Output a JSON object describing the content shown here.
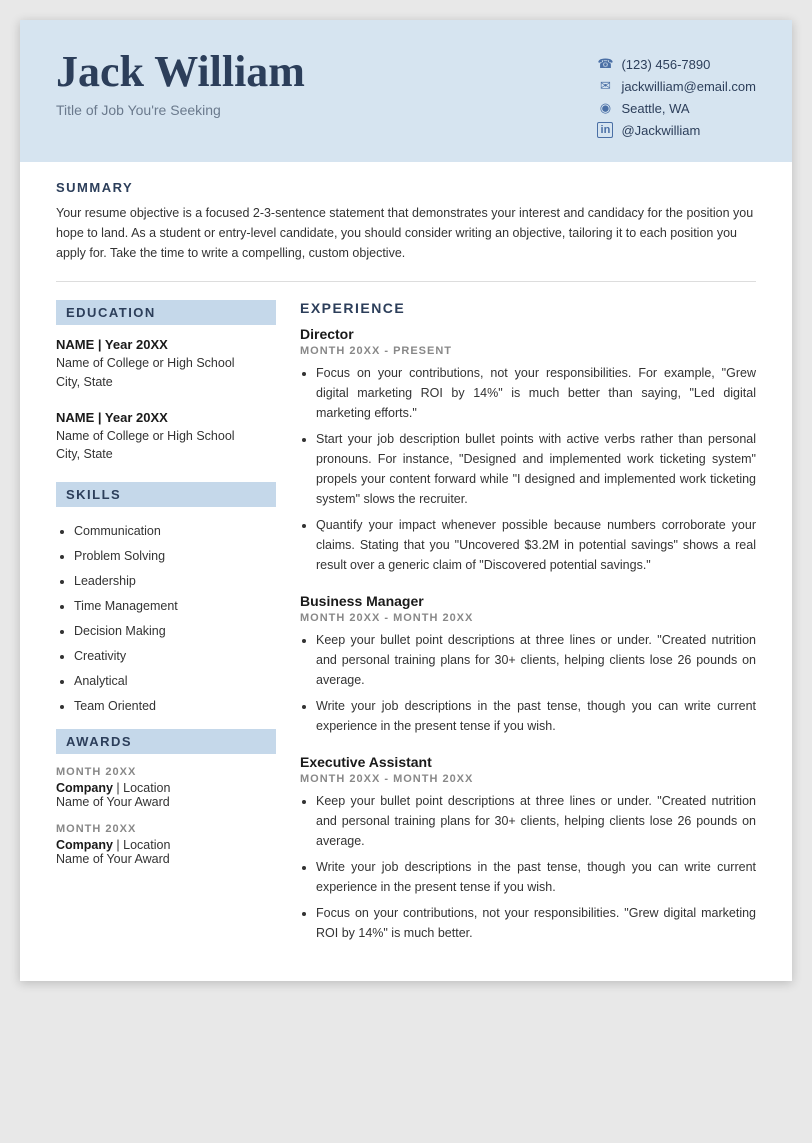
{
  "header": {
    "name": "Jack William",
    "title": "Title of Job You're Seeking",
    "phone": "(123) 456-7890",
    "email": "jackwilliam@email.com",
    "location": "Seattle, WA",
    "linkedin": "@Jackwilliam"
  },
  "summary": {
    "section_label": "SUMMARY",
    "text": "Your resume objective is a focused 2-3-sentence statement that demonstrates your interest and candidacy for the position you hope to land. As a student or entry-level candidate, you should consider writing an objective, tailoring it to each position you apply for. Take the time to write a compelling, custom objective."
  },
  "education": {
    "section_label": "EDUCATION",
    "entries": [
      {
        "name": "NAME | Year 20XX",
        "school": "Name of College or High School",
        "location": "City, State"
      },
      {
        "name": "NAME | Year 20XX",
        "school": "Name of College or High School",
        "location": "City, State"
      }
    ]
  },
  "skills": {
    "section_label": "SKILLS",
    "items": [
      "Communication",
      "Problem Solving",
      "Leadership",
      "Time Management",
      "Decision Making",
      "Creativity",
      "Analytical",
      "Team Oriented"
    ]
  },
  "awards": {
    "section_label": "AWARDS",
    "entries": [
      {
        "month": "MONTH 20XX",
        "company": "Company",
        "location_label": "Location",
        "award_name": "Name of Your Award"
      },
      {
        "month": "MONTH 20XX",
        "company": "Company",
        "location_label": "Location",
        "award_name": "Name of Your Award"
      }
    ]
  },
  "experience": {
    "section_label": "EXPERIENCE",
    "entries": [
      {
        "title": "Director",
        "dates": "MONTH 20XX - PRESENT",
        "bullets": [
          "Focus on your contributions, not your responsibilities. For example, \"Grew digital marketing ROI by 14%\" is much better than saying, \"Led digital marketing efforts.\"",
          "Start your job description bullet points with active verbs rather than personal pronouns. For instance, \"Designed and implemented work ticketing system\" propels your content forward while \"I designed and implemented work ticketing system\" slows the recruiter.",
          "Quantify your impact whenever possible because numbers corroborate your claims. Stating that you \"Uncovered $3.2M in potential savings\" shows a real result over a generic claim of \"Discovered potential savings.\""
        ]
      },
      {
        "title": "Business Manager",
        "dates": "MONTH 20XX - MONTH 20XX",
        "bullets": [
          "Keep your bullet point descriptions at three lines or under. \"Created nutrition and personal training plans for 30+ clients, helping clients lose 26 pounds on average.",
          "Write your job descriptions in the past tense, though you can write current experience in the present tense if you wish."
        ]
      },
      {
        "title": "Executive Assistant",
        "dates": "MONTH 20XX - MONTH 20XX",
        "bullets": [
          "Keep your bullet point descriptions at three lines or under. \"Created nutrition and personal training plans for 30+ clients, helping clients lose 26 pounds on average.",
          "Write your job descriptions in the past tense, though you can write current experience in the present tense if you wish.",
          "Focus on your contributions, not your responsibilities. \"Grew digital marketing ROI by 14%\" is much better."
        ]
      }
    ]
  },
  "icons": {
    "phone": "☎",
    "email": "✉",
    "location": "📍",
    "linkedin": "in"
  }
}
